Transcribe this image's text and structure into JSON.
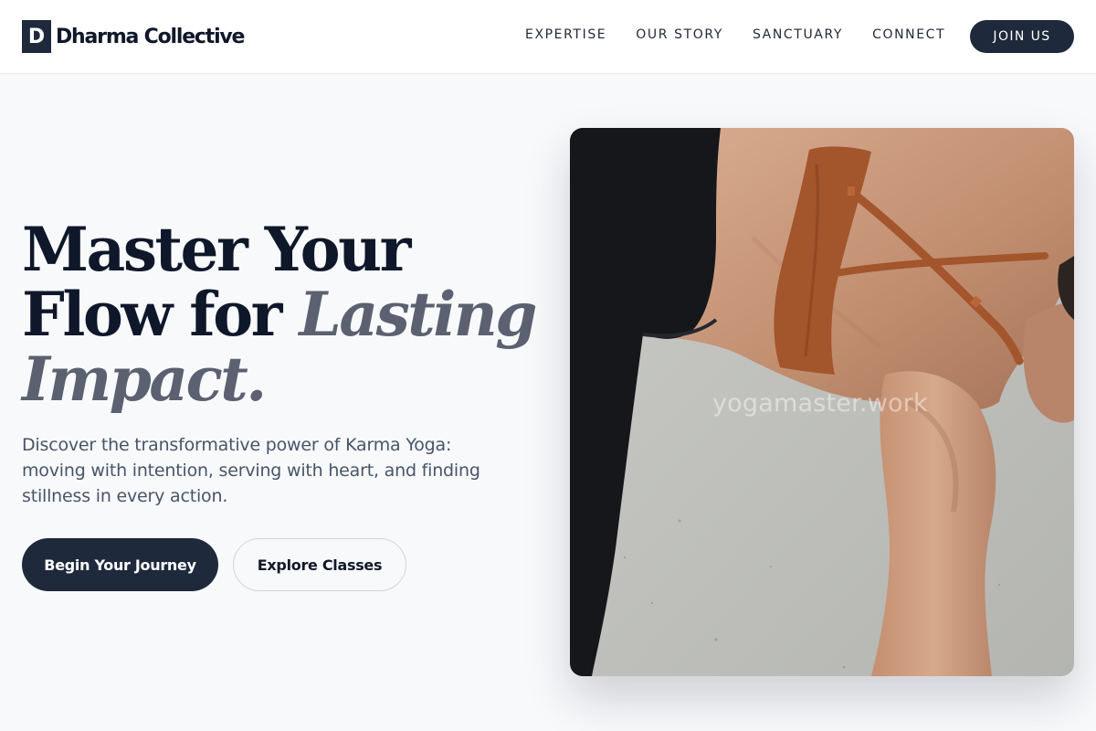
{
  "brand": {
    "mark": "D",
    "name": "Dharma Collective"
  },
  "nav": {
    "items": [
      "EXPERTISE",
      "OUR STORY",
      "SANCTUARY",
      "CONNECT"
    ],
    "cta_label": "JOIN US"
  },
  "hero": {
    "headline_line1": "Master Your",
    "headline_line2_plain": "Flow for ",
    "headline_line2_accent": "Lasting",
    "headline_line3_accent": "Impact.",
    "subtitle": "Discover the transformative power of Karma Yoga: moving with intention, serving with heart, and finding stillness in every action.",
    "primary_button": "Begin Your Journey",
    "secondary_button": "Explore Classes",
    "image": {
      "watermark": "yogamaster.work"
    }
  },
  "colors": {
    "primary_dark": "#1e293b",
    "accent_gray": "#5b6170",
    "background": "#f8f9fb"
  }
}
